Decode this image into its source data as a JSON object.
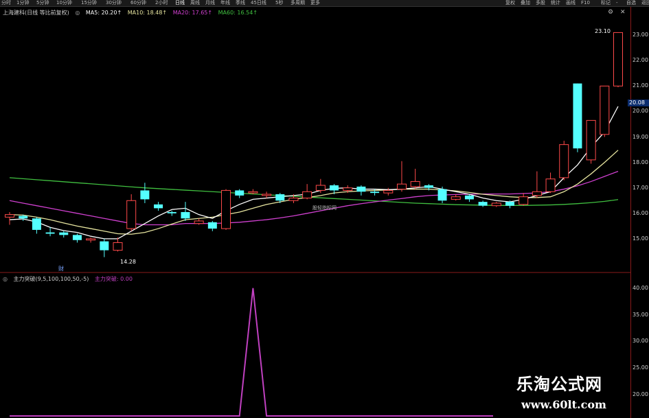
{
  "toolbar": {
    "periods": [
      "分时",
      "1分钟",
      "5分钟",
      "10分钟",
      "15分钟",
      "30分钟",
      "60分钟",
      "2小时",
      "日线",
      "周线",
      "月线",
      "年线",
      "季线",
      "45日线",
      "5秒",
      "多周期",
      "更多"
    ],
    "active_index": 8,
    "right": [
      "复权",
      "叠加",
      "多股",
      "统计",
      "画线",
      "F10",
      "标记",
      "-",
      "自选",
      "返回"
    ]
  },
  "header": {
    "title": "上海建科(日线 等比前复权)",
    "ma5": "MA5: 20.20↑",
    "ma10": "MA10: 18.48↑",
    "ma20": "MA20: 17.65↑",
    "ma60": "MA60: 16.54↑",
    "colors": {
      "ma5": "#ffffff",
      "ma10": "#e8e6a0",
      "ma20": "#d040d0",
      "ma60": "#40c040"
    }
  },
  "indicator": {
    "title": "主力突破(9,5,100,100,50,-5)",
    "value": "主力突破: 0.00",
    "color": "#c040c0"
  },
  "price_axis": [
    "23.00",
    "22.00",
    "21.00",
    "20.00",
    "19.00",
    "18.00",
    "17.00",
    "16.00",
    "15.00"
  ],
  "indicator_axis": [
    "40.00",
    "35.00",
    "30.00",
    "25.00",
    "20.00"
  ],
  "last_price": "20.08",
  "annotations": {
    "high": "23.10",
    "low": "14.28",
    "mark": "财",
    "watermark_inline": "股轻指标网"
  },
  "watermark": {
    "line1": "乐淘公式网",
    "line2": "www.60lt.com"
  },
  "chart_data": {
    "type": "candlestick",
    "up_color": "#ff4a4a",
    "down_color": "#54ffff",
    "ylim": [
      14.0,
      23.3
    ],
    "candles": [
      {
        "o": 15.85,
        "c": 15.95,
        "h": 16.05,
        "l": 15.55
      },
      {
        "o": 15.9,
        "c": 15.8,
        "h": 15.95,
        "l": 15.7
      },
      {
        "o": 15.8,
        "c": 15.35,
        "h": 15.85,
        "l": 15.2
      },
      {
        "o": 15.25,
        "c": 15.2,
        "h": 15.45,
        "l": 15.1
      },
      {
        "o": 15.25,
        "c": 15.15,
        "h": 15.3,
        "l": 15.05
      },
      {
        "o": 15.15,
        "c": 14.95,
        "h": 15.2,
        "l": 14.85
      },
      {
        "o": 14.95,
        "c": 15.0,
        "h": 15.05,
        "l": 14.85
      },
      {
        "o": 14.9,
        "c": 14.55,
        "h": 15.0,
        "l": 14.28
      },
      {
        "o": 14.55,
        "c": 14.85,
        "h": 15.05,
        "l": 14.5
      },
      {
        "o": 15.4,
        "c": 16.5,
        "h": 16.75,
        "l": 15.3
      },
      {
        "o": 16.9,
        "c": 16.55,
        "h": 17.2,
        "l": 16.4
      },
      {
        "o": 16.35,
        "c": 16.2,
        "h": 16.45,
        "l": 16.1
      },
      {
        "o": 16.05,
        "c": 16.0,
        "h": 16.1,
        "l": 15.9
      },
      {
        "o": 16.05,
        "c": 15.8,
        "h": 16.45,
        "l": 15.7
      },
      {
        "o": 15.6,
        "c": 15.7,
        "h": 15.8,
        "l": 15.55
      },
      {
        "o": 15.65,
        "c": 15.4,
        "h": 15.7,
        "l": 15.3
      },
      {
        "o": 15.4,
        "c": 16.9,
        "h": 16.95,
        "l": 15.35
      },
      {
        "o": 16.9,
        "c": 16.7,
        "h": 16.95,
        "l": 16.6
      },
      {
        "o": 16.8,
        "c": 16.85,
        "h": 16.95,
        "l": 16.75
      },
      {
        "o": 16.7,
        "c": 16.75,
        "h": 16.85,
        "l": 16.6
      },
      {
        "o": 16.75,
        "c": 16.5,
        "h": 16.8,
        "l": 16.4
      },
      {
        "o": 16.5,
        "c": 16.6,
        "h": 16.75,
        "l": 16.4
      },
      {
        "o": 16.6,
        "c": 16.85,
        "h": 17.15,
        "l": 16.55
      },
      {
        "o": 16.9,
        "c": 17.1,
        "h": 17.35,
        "l": 16.8
      },
      {
        "o": 17.1,
        "c": 16.9,
        "h": 17.15,
        "l": 16.75
      },
      {
        "o": 16.9,
        "c": 17.0,
        "h": 17.1,
        "l": 16.8
      },
      {
        "o": 17.05,
        "c": 16.85,
        "h": 17.1,
        "l": 16.7
      },
      {
        "o": 16.85,
        "c": 16.8,
        "h": 16.95,
        "l": 16.7
      },
      {
        "o": 16.8,
        "c": 16.9,
        "h": 17.0,
        "l": 16.7
      },
      {
        "o": 16.95,
        "c": 17.15,
        "h": 18.05,
        "l": 16.85
      },
      {
        "o": 17.05,
        "c": 17.25,
        "h": 17.75,
        "l": 16.95
      },
      {
        "o": 17.1,
        "c": 17.0,
        "h": 17.15,
        "l": 16.9
      },
      {
        "o": 16.95,
        "c": 16.5,
        "h": 17.05,
        "l": 16.4
      },
      {
        "o": 16.55,
        "c": 16.65,
        "h": 16.75,
        "l": 16.5
      },
      {
        "o": 16.7,
        "c": 16.55,
        "h": 16.75,
        "l": 16.45
      },
      {
        "o": 16.45,
        "c": 16.3,
        "h": 16.5,
        "l": 16.25
      },
      {
        "o": 16.3,
        "c": 16.4,
        "h": 16.45,
        "l": 16.25
      },
      {
        "o": 16.45,
        "c": 16.3,
        "h": 16.5,
        "l": 16.2
      },
      {
        "o": 16.35,
        "c": 16.65,
        "h": 16.8,
        "l": 16.3
      },
      {
        "o": 16.7,
        "c": 16.85,
        "h": 17.65,
        "l": 16.6
      },
      {
        "o": 16.85,
        "c": 17.35,
        "h": 17.6,
        "l": 16.8
      },
      {
        "o": 17.4,
        "c": 18.7,
        "h": 18.85,
        "l": 17.3
      },
      {
        "o": 21.1,
        "c": 18.55,
        "h": 21.1,
        "l": 18.4
      },
      {
        "o": 18.1,
        "c": 19.65,
        "h": 19.65,
        "l": 17.95
      },
      {
        "o": 19.1,
        "c": 21.0,
        "h": 21.0,
        "l": 19.0
      },
      {
        "o": 21.0,
        "c": 23.1,
        "h": 23.1,
        "l": 20.95
      }
    ],
    "ma5": [
      15.75,
      15.78,
      15.66,
      15.45,
      15.32,
      15.25,
      15.1,
      15.0,
      15.0,
      15.3,
      15.6,
      15.9,
      16.15,
      16.2,
      15.95,
      15.8,
      16.1,
      16.35,
      16.55,
      16.6,
      16.65,
      16.7,
      16.75,
      16.9,
      16.98,
      17.0,
      16.95,
      16.95,
      16.93,
      16.95,
      17.0,
      17.05,
      16.95,
      16.85,
      16.75,
      16.6,
      16.5,
      16.45,
      16.55,
      16.7,
      16.85,
      17.4,
      17.9,
      18.6,
      19.2,
      20.2
    ],
    "ma10": [
      15.95,
      15.93,
      15.85,
      15.75,
      15.62,
      15.5,
      15.4,
      15.3,
      15.2,
      15.18,
      15.25,
      15.4,
      15.58,
      15.75,
      15.8,
      15.85,
      15.95,
      16.05,
      16.2,
      16.35,
      16.45,
      16.55,
      16.62,
      16.7,
      16.8,
      16.85,
      16.88,
      16.9,
      16.92,
      16.95,
      16.95,
      16.95,
      16.92,
      16.88,
      16.82,
      16.75,
      16.7,
      16.65,
      16.62,
      16.62,
      16.65,
      16.85,
      17.15,
      17.55,
      18.0,
      18.48
    ],
    "ma20": [
      16.5,
      16.4,
      16.3,
      16.2,
      16.1,
      16.0,
      15.9,
      15.8,
      15.7,
      15.6,
      15.55,
      15.55,
      15.55,
      15.6,
      15.6,
      15.6,
      15.62,
      15.65,
      15.7,
      15.75,
      15.82,
      15.9,
      16.0,
      16.1,
      16.2,
      16.3,
      16.38,
      16.45,
      16.52,
      16.58,
      16.65,
      16.7,
      16.72,
      16.74,
      16.75,
      16.76,
      16.76,
      16.76,
      16.78,
      16.8,
      16.85,
      16.95,
      17.08,
      17.25,
      17.45,
      17.65
    ],
    "ma60": [
      17.4,
      17.36,
      17.32,
      17.28,
      17.24,
      17.2,
      17.16,
      17.12,
      17.08,
      17.04,
      17.0,
      16.97,
      16.94,
      16.91,
      16.88,
      16.85,
      16.82,
      16.79,
      16.76,
      16.73,
      16.7,
      16.67,
      16.64,
      16.61,
      16.58,
      16.55,
      16.52,
      16.49,
      16.46,
      16.43,
      16.4,
      16.38,
      16.36,
      16.34,
      16.33,
      16.32,
      16.31,
      16.31,
      16.31,
      16.32,
      16.33,
      16.35,
      16.38,
      16.42,
      16.47,
      16.54
    ],
    "indicator": {
      "xlim": [
        0,
        45
      ],
      "ylim": [
        16,
        41
      ],
      "values": [
        0,
        0,
        0,
        0,
        0,
        0,
        0,
        0,
        0,
        0,
        0,
        0,
        0,
        0,
        0,
        0,
        0,
        0,
        40,
        0,
        0,
        0,
        0,
        0,
        0,
        0,
        0,
        0,
        0,
        0,
        0,
        0,
        0,
        0,
        0,
        0,
        0,
        0,
        0,
        0,
        0,
        0,
        0,
        0,
        0,
        0
      ]
    }
  }
}
